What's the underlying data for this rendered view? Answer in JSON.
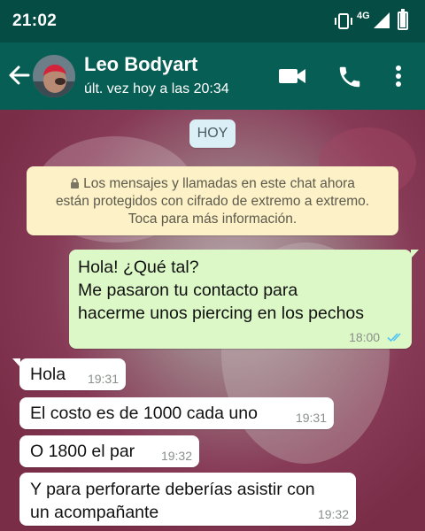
{
  "status_bar": {
    "time": "21:02",
    "network": "4G"
  },
  "header": {
    "contact_name": "Leo Bodyart",
    "last_seen": "últ. vez hoy a las 20:34"
  },
  "chat": {
    "day_label": "HOY",
    "encryption_notice": [
      "Los mensajes y llamadas en este chat ahora",
      "están protegidos con cifrado de extremo a extremo.",
      "Toca para más información."
    ],
    "messages": [
      {
        "direction": "outgoing",
        "lines": [
          "Hola! ¿Qué tal?",
          "Me pasaron tu contacto para",
          "hacerme unos piercing en los pechos"
        ],
        "time": "18:00",
        "read": true
      },
      {
        "direction": "incoming",
        "text": "Hola",
        "time": "19:31"
      },
      {
        "direction": "incoming",
        "text": "El costo es de 1000 cada uno",
        "time": "19:31"
      },
      {
        "direction": "incoming",
        "text": "O 1800 el par",
        "time": "19:32"
      },
      {
        "direction": "incoming",
        "lines": [
          "Y para perforarte deberías asistir con",
          "un acompañante"
        ],
        "time": "19:32"
      }
    ]
  },
  "colors": {
    "status_bar": "#054d44",
    "app_bar": "#075e54",
    "outgoing_bubble": "#dcf8c6",
    "incoming_bubble": "#ffffff",
    "read_ticks": "#4fc3f7",
    "notice_bubble": "#fcf1c7"
  },
  "icons": {
    "back": "arrow-left-icon",
    "video": "video-camera-icon",
    "call": "phone-icon",
    "menu": "more-vertical-icon",
    "lock": "lock-icon",
    "ticks": "double-check-icon"
  }
}
